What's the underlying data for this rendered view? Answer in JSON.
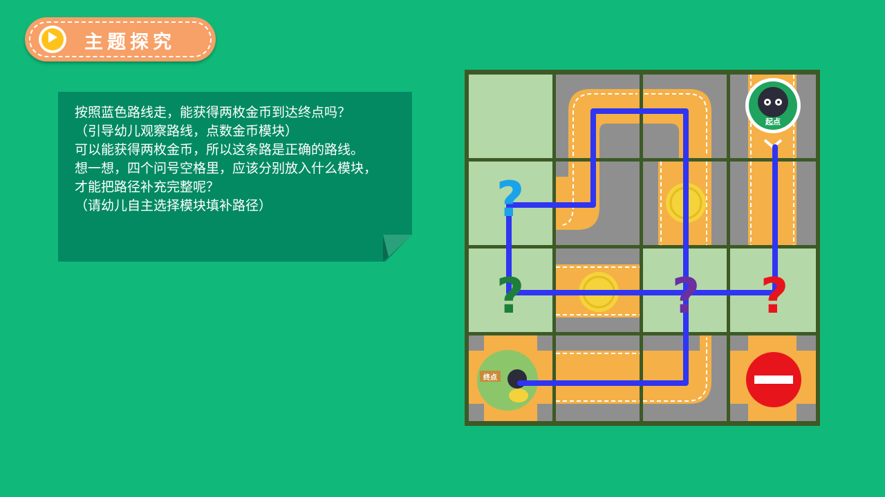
{
  "header": {
    "title": "主题探究",
    "play_icon": "play-icon"
  },
  "note": {
    "lines": [
      "按照蓝色路线走，能获得两枚金币到达终点吗？",
      "（引导幼儿观察路线，点数金币模块）",
      "",
      "可以能获得两枚金币，所以这条路是正确的路线。",
      "",
      "想一想，四个问号空格里，应该分别放入什么模块，",
      "才能把路径补充完整呢？",
      "（请幼儿自主选择模块填补路径）"
    ]
  },
  "board": {
    "grid_size": "4x4",
    "start_badge_text": "起点",
    "end_sign_text": "终点",
    "question_mark": "?",
    "question_colors": [
      "#1aa3e8",
      "#1e7f3a",
      "#6a2fa0",
      "#e8141c"
    ],
    "path_color": "#2f35f2",
    "road_color": "#f5b047",
    "coin_color": "#f5d33a",
    "stop_sign": "no-entry-icon",
    "colors": {
      "background": "#10b979",
      "note_bg": "#038a62",
      "title_pill": "#f7a067",
      "grass_tile": "#b5d8a9",
      "grey_tile": "#8f8f8f",
      "frame": "#3d5a26"
    }
  }
}
